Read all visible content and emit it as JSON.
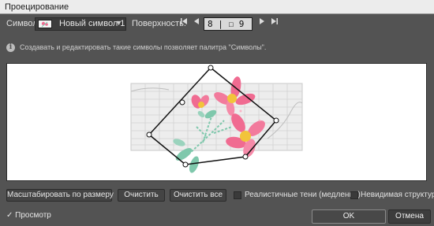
{
  "window": {
    "title": "Проецирование"
  },
  "symbol": {
    "label": "Символ:",
    "selected": "Новый символ 1"
  },
  "surface": {
    "label": "Поверхность:",
    "value": "8 | ☐ 9"
  },
  "info": {
    "text": "Создавать и редактировать такие символы позволяет палитра \"Символы\"."
  },
  "buttons": {
    "fit": "Масштабировать по размеру",
    "clear": "Очистить",
    "clear_all": "Очистить все",
    "ok": "OK",
    "cancel": "Отмена"
  },
  "options": {
    "realistic_shadows": "Реалистичные тени (медленно)",
    "invisible_structure": "Невидимая структура",
    "preview": "Просмотр"
  },
  "colors": {
    "petal": "#f06b91",
    "center": "#f2c43a",
    "leaf": "#7fc8ac",
    "grid": "#cfcfcf"
  }
}
